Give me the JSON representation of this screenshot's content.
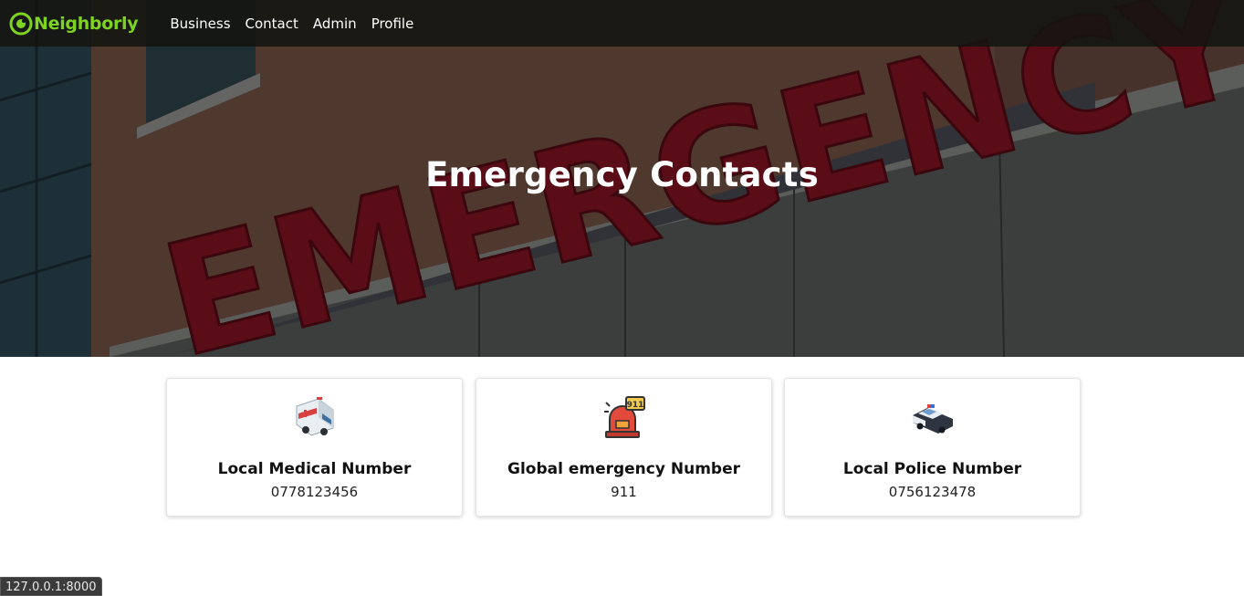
{
  "brand": {
    "name": "Neighborly",
    "color": "#7ed321"
  },
  "nav": {
    "items": [
      "Business",
      "Contact",
      "Admin",
      "Profile"
    ]
  },
  "hero": {
    "title": "Emergency Contacts",
    "sign_text": "EMERGENCY"
  },
  "cards": [
    {
      "icon": "ambulance-icon",
      "label": "Local Medical Number",
      "number": "0778123456"
    },
    {
      "icon": "alarm-siren-911-icon",
      "label": "Global emergency Number",
      "number": "911"
    },
    {
      "icon": "police-car-icon",
      "label": "Local Police Number",
      "number": "0756123478"
    }
  ],
  "status_bar": {
    "url": "127.0.0.1:8000"
  }
}
